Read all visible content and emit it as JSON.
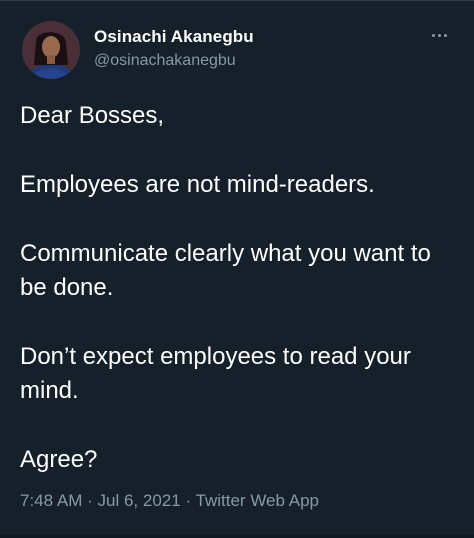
{
  "author": {
    "name": "Osinachi Akanegbu",
    "handle": "@osinachakanegbu"
  },
  "menu_icon": "more-dots-icon",
  "tweet": {
    "paragraphs": [
      "Dear Bosses,",
      "Employees are not mind-readers.",
      "Communicate clearly what you want to be done.",
      "Don’t expect employees to read your mind.",
      "Agree?"
    ]
  },
  "meta": {
    "time": "7:48 AM",
    "separator": "·",
    "date": "Jul 6, 2021",
    "source": "Twitter Web App"
  },
  "colors": {
    "background": "#15202b",
    "primary_text": "#ffffff",
    "secondary_text": "#8899a6"
  }
}
